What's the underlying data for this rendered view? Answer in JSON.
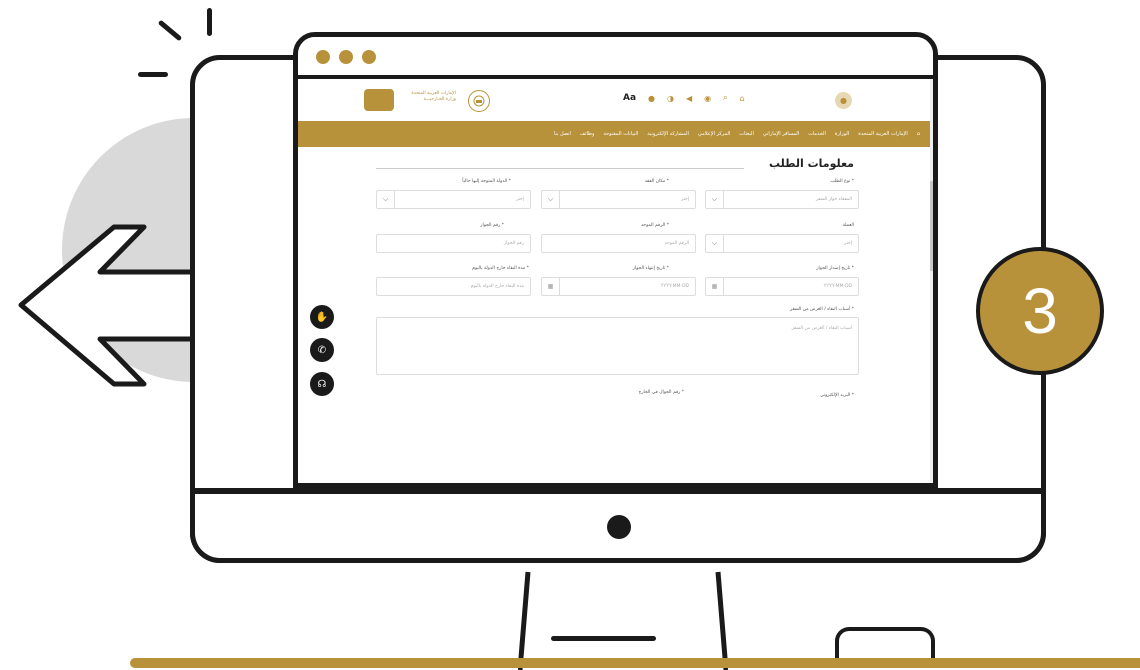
{
  "badge": {
    "number": "3"
  },
  "header": {
    "logo_text_line1": "الإمارات العربية المتحدة",
    "logo_text_line2": "وزارة الخـارجيـــة",
    "toolbar_icons": [
      "font-size-icon",
      "palette-icon",
      "contrast-icon",
      "speaker-icon",
      "globe-icon",
      "search-icon",
      "home-icon"
    ],
    "font_label": "Aa"
  },
  "nav": {
    "items": [
      "الإمارات العربية المتحدة",
      "الوزارة",
      "الخدمات",
      "المسافر الإماراتي",
      "البعثات",
      "المركز الإعلامي",
      "المشاركة الإلكترونية",
      "البيانات المفتوحة",
      "وظائف",
      "اتصل بنا"
    ]
  },
  "form": {
    "section_title": "معلومات الطلب",
    "fields": {
      "request_type": {
        "label": "نوع الطلب *",
        "placeholder": "المفقاء جواز السفر"
      },
      "place_of_loss": {
        "label": "مكان الفقد *",
        "placeholder": "إختر"
      },
      "target_country": {
        "label": "الدولة المتوجه إليها حالياً *",
        "placeholder": "إختر"
      },
      "currency": {
        "label": "العملة",
        "placeholder": "إختر"
      },
      "unified_number": {
        "label": "الرقم الموحد *",
        "placeholder": "الرقم الموحد"
      },
      "passport_number": {
        "label": "رقم الجواز *",
        "placeholder": "رقم الجواز"
      },
      "passport_issue_date": {
        "label": "تاريخ إصدار الجواز *",
        "placeholder": "YYYY-MM-DD"
      },
      "passport_expiry_date": {
        "label": "تاريخ إنتهاء الجواز *",
        "placeholder": "YYYY-MM-DD"
      },
      "stay_duration": {
        "label": "مدة البقاء خارج الدولة باليوم *",
        "placeholder": "مدة البقاء خارج الدولة باليوم"
      },
      "reasons": {
        "label": "أسباب البقاء / الغرض من السفر *",
        "placeholder": "أسباب البقاء / الغرض من السفر"
      },
      "email": {
        "label": "البريد الإلكتروني *"
      },
      "abroad_phone": {
        "label": "رقم الجوال في الخارج *"
      }
    }
  },
  "colors": {
    "accent": "#b8923b",
    "outline": "#1a1a1a",
    "backdrop": "#d9d9d9"
  }
}
